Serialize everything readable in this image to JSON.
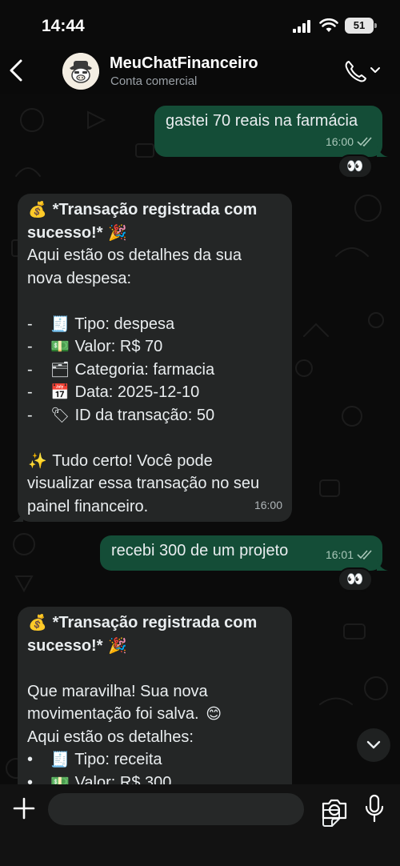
{
  "status": {
    "time": "14:44",
    "battery": "51"
  },
  "header": {
    "name": "MeuChatFinanceiro",
    "subtitle": "Conta comercial"
  },
  "messages": [
    {
      "dir": "out",
      "text": "gastei 70 reais na farmácia",
      "time": "16:00",
      "reaction": "👀"
    },
    {
      "dir": "in",
      "time": "16:00",
      "lines": [
        {
          "emoji": "💰",
          "text": "*Transação registrada com",
          "bold": true
        },
        {
          "text": "sucesso!*",
          "emoji_after": "🎉",
          "bold": true
        },
        {
          "text": "Aqui estão os detalhes da sua"
        },
        {
          "text": "nova despesa:"
        },
        {
          "text": ""
        },
        {
          "bullet": "-",
          "emoji": "🧾",
          "text": "Tipo: despesa"
        },
        {
          "bullet": "-",
          "emoji": "💵",
          "text": "Valor: R$ 70"
        },
        {
          "bullet": "-",
          "emoji": "🗂",
          "text": "Categoria: farmacia"
        },
        {
          "bullet": "-",
          "emoji": "📅",
          "text": "Data: 2025-12-10"
        },
        {
          "bullet": "-",
          "emoji": "🏷",
          "text": "ID da transação: 50"
        },
        {
          "text": ""
        },
        {
          "emoji": "✨",
          "text": "Tudo certo! Você pode"
        },
        {
          "text": "visualizar essa transação no seu"
        },
        {
          "text": "painel financeiro."
        }
      ]
    },
    {
      "dir": "out",
      "text": "recebi 300 de um projeto",
      "time": "16:01",
      "reaction": "👀"
    },
    {
      "dir": "in",
      "time": "",
      "lines": [
        {
          "emoji": "💰",
          "text": "*Transação registrada com",
          "bold": true
        },
        {
          "text": "sucesso!*",
          "emoji_after": "🎉",
          "bold": true
        },
        {
          "text": ""
        },
        {
          "text": "Que maravilha! Sua nova"
        },
        {
          "text": "movimentação foi salva.",
          "emoji_after": "😊"
        },
        {
          "text": "Aqui estão os detalhes:"
        },
        {
          "bullet": "•",
          "emoji": "🧾",
          "text": "Tipo: receita"
        },
        {
          "bullet": "•",
          "emoji": "💵",
          "text": "Valor: R$ 300"
        }
      ]
    }
  ],
  "composer": {
    "placeholder": ""
  },
  "colors": {
    "outgoing_bubble": "#144d37",
    "incoming_bubble": "#242626",
    "background": "#0b0b0b",
    "read_ticks": "#a9c7b9"
  }
}
